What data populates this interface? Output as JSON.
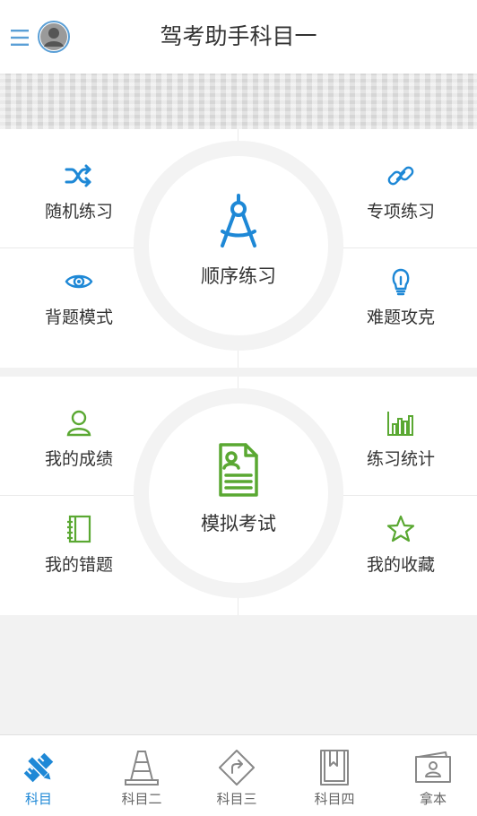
{
  "header": {
    "title": "驾考助手科目一"
  },
  "section1": {
    "top_left": "随机练习",
    "top_right": "专项练习",
    "bottom_left": "背题模式",
    "bottom_right": "难题攻克",
    "center": "顺序练习"
  },
  "section2": {
    "top_left": "我的成绩",
    "top_right": "练习统计",
    "bottom_left": "我的错题",
    "bottom_right": "我的收藏",
    "center": "模拟考试"
  },
  "tabbar": {
    "tabs": [
      "科目",
      "科目二",
      "科目三",
      "科目四",
      "拿本"
    ],
    "active": "科目"
  },
  "colors": {
    "blue": "#1e88d6",
    "green": "#5aa832",
    "gray": "#888888"
  }
}
